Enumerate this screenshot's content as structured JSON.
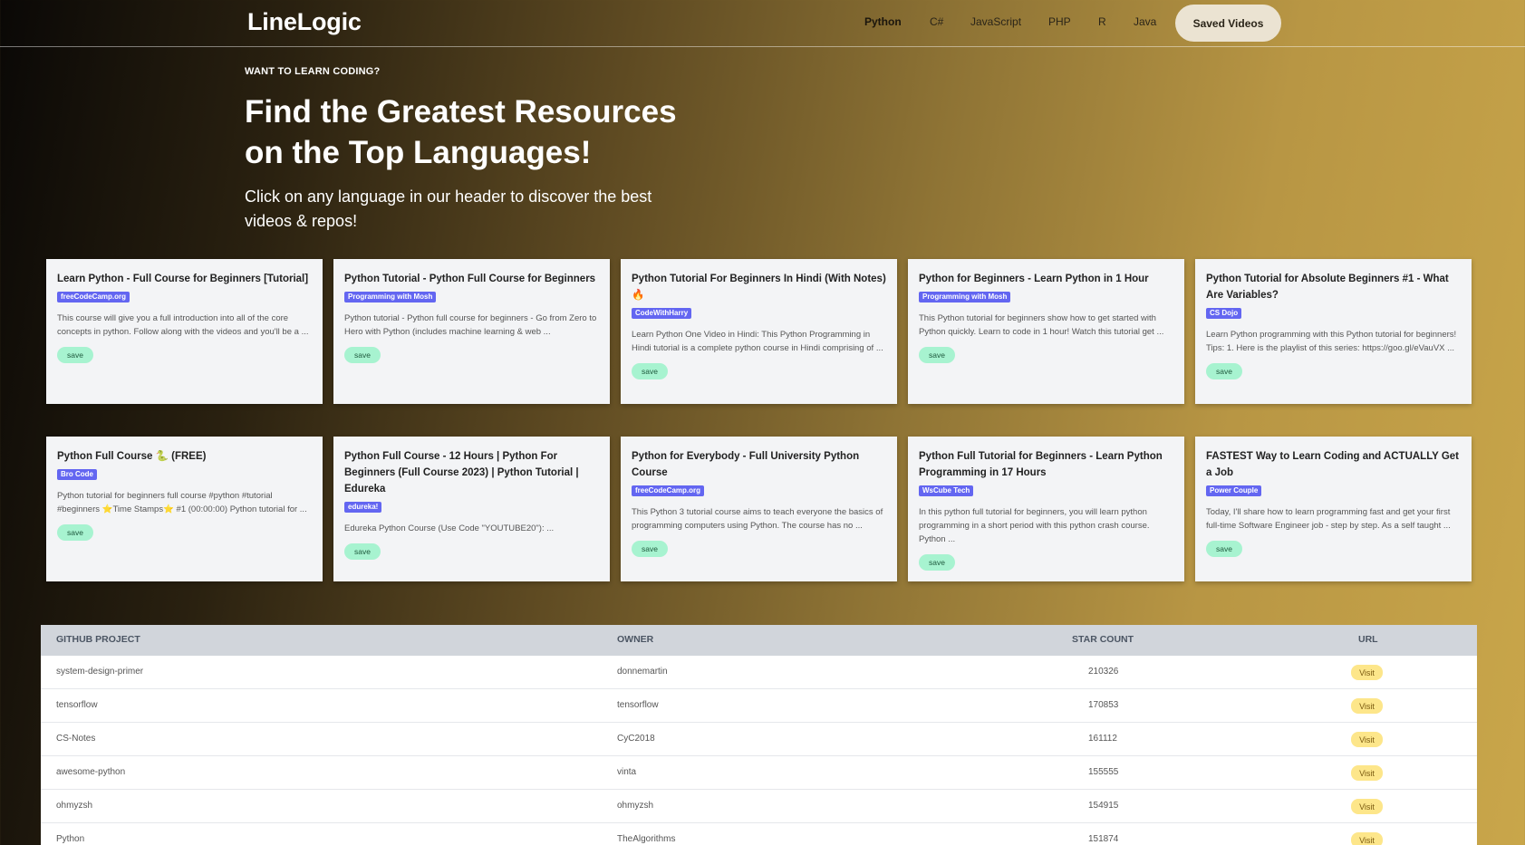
{
  "header": {
    "brand": "LineLogic",
    "nav": [
      "Python",
      "C#",
      "JavaScript",
      "PHP",
      "R",
      "Java"
    ],
    "active": "Python",
    "saved_label": "Saved Videos"
  },
  "hero": {
    "eyebrow": "WANT TO LEARN CODING?",
    "title": "Find the Greatest Resources on the Top Languages!",
    "subtitle": "Click on any language in our header to discover the best videos & repos!"
  },
  "cards": [
    {
      "title": "Learn Python - Full Course for Beginners [Tutorial]",
      "channel": "freeCodeCamp.org",
      "desc": "This course will give you a full introduction into all of the core concepts in python. Follow along with the videos and you'll be a ...",
      "save": "save"
    },
    {
      "title": "Python Tutorial - Python Full Course for Beginners",
      "channel": "Programming with Mosh",
      "desc": "Python tutorial - Python full course for beginners - Go from Zero to Hero with Python (includes machine learning & web ...",
      "save": "save"
    },
    {
      "title": "Python Tutorial For Beginners In Hindi (With Notes) 🔥",
      "channel": "CodeWithHarry",
      "desc": "Learn Python One Video in Hindi: This Python Programming in Hindi tutorial is a complete python course in Hindi comprising of ...",
      "save": "save"
    },
    {
      "title": "Python for Beginners - Learn Python in 1 Hour",
      "channel": "Programming with Mosh",
      "desc": "This Python tutorial for beginners show how to get started with Python quickly. Learn to code in 1 hour! Watch this tutorial get ...",
      "save": "save"
    },
    {
      "title": "Python Tutorial for Absolute Beginners #1 - What Are Variables?",
      "channel": "CS Dojo",
      "desc": "Learn Python programming with this Python tutorial for beginners! Tips: 1. Here is the playlist of this series: https://goo.gl/eVauVX ...",
      "save": "save"
    },
    {
      "title": "Python Full Course 🐍 (FREE)",
      "channel": "Bro Code",
      "desc": "Python tutorial for beginners full course #python #tutorial #beginners ⭐️Time Stamps⭐️ #1 (00:00:00) Python tutorial for ...",
      "save": "save"
    },
    {
      "title": "Python Full Course - 12 Hours | Python For Beginners (Full Course 2023) | Python Tutorial | Edureka",
      "channel": "edureka!",
      "desc": "Edureka Python Course (Use Code \"YOUTUBE20\"): ...",
      "save": "save"
    },
    {
      "title": "Python for Everybody - Full University Python Course",
      "channel": "freeCodeCamp.org",
      "desc": "This Python 3 tutorial course aims to teach everyone the basics of programming computers using Python. The course has no ...",
      "save": "save"
    },
    {
      "title": "Python Full Tutorial for Beginners - Learn Python Programming in 17 Hours",
      "channel": "WsCube Tech",
      "desc": "In this python full tutorial for beginners, you will learn python programming in a short period with this python crash course. Python ...",
      "save": "save"
    },
    {
      "title": "FASTEST Way to Learn Coding and ACTUALLY Get a Job",
      "channel": "Power Couple",
      "desc": "Today, I'll share how to learn programming fast and get your first full-time Software Engineer job - step by step. As a self taught ...",
      "save": "save"
    }
  ],
  "table": {
    "headers": [
      "GITHUB PROJECT",
      "OWNER",
      "STAR COUNT",
      "URL"
    ],
    "visit_label": "Visit",
    "rows": [
      {
        "project": "system-design-primer",
        "owner": "donnemartin",
        "stars": "210326"
      },
      {
        "project": "tensorflow",
        "owner": "tensorflow",
        "stars": "170853"
      },
      {
        "project": "CS-Notes",
        "owner": "CyC2018",
        "stars": "161112"
      },
      {
        "project": "awesome-python",
        "owner": "vinta",
        "stars": "155555"
      },
      {
        "project": "ohmyzsh",
        "owner": "ohmyzsh",
        "stars": "154915"
      },
      {
        "project": "Python",
        "owner": "TheAlgorithms",
        "stars": "151874"
      }
    ]
  }
}
